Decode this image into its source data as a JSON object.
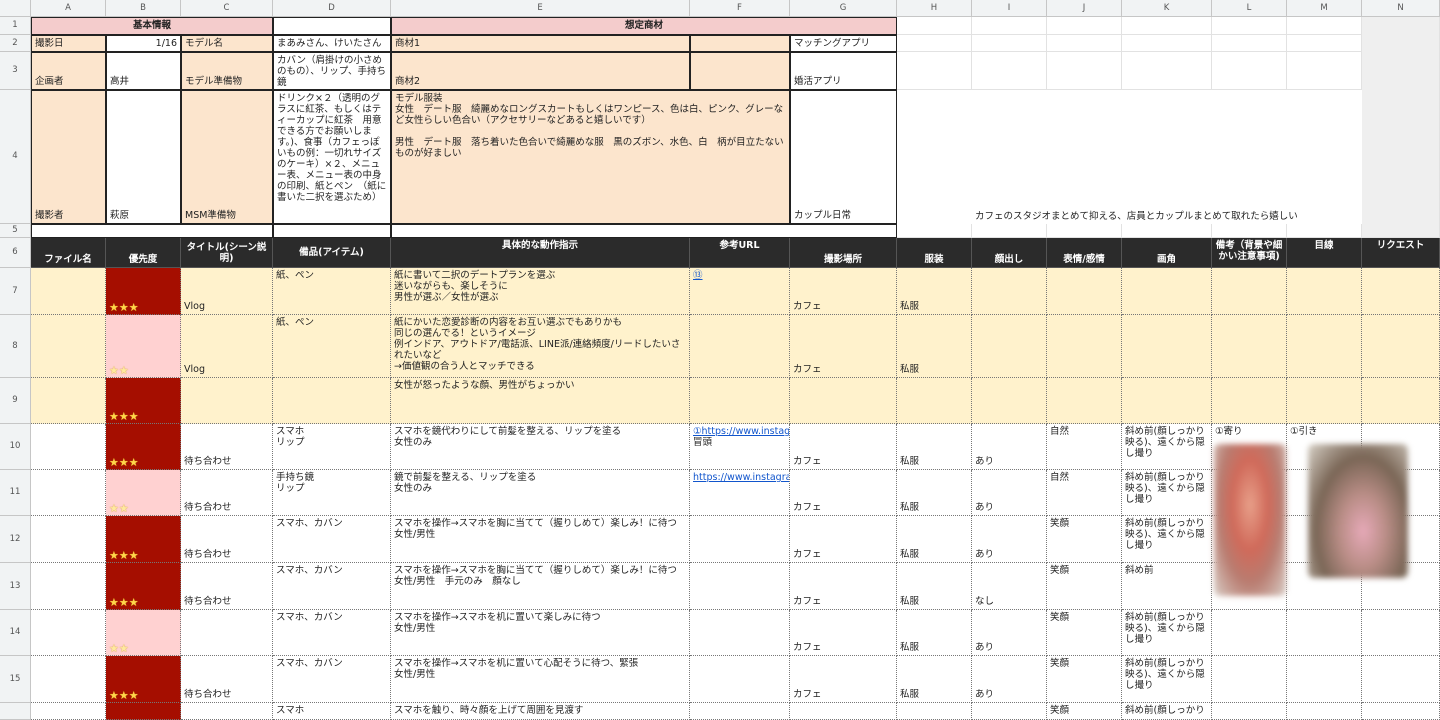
{
  "columns": [
    "A",
    "B",
    "C",
    "D",
    "E",
    "F",
    "G",
    "H",
    "I",
    "J",
    "K",
    "L",
    "M",
    "N"
  ],
  "rows": [
    "1",
    "2",
    "3",
    "4",
    "5",
    "6",
    "7",
    "8",
    "9",
    "10",
    "11",
    "12",
    "13",
    "14",
    "15",
    ""
  ],
  "info": {
    "title_basic": "基本情報",
    "title_product": "想定商材",
    "shoot_date_label": "撮影日",
    "shoot_date": "1/16",
    "model_name_label": "モデル名",
    "model_name": "まあみさん、けいたさん",
    "planner_label": "企画者",
    "planner": "高井",
    "model_prep_label": "モデル準備物",
    "model_prep": "カバン（肩掛けの小さめのもの）、リップ、手持ち鏡",
    "photographer_label": "撮影者",
    "photographer": "萩原",
    "msm_prep_label": "MSM準備物",
    "msm_prep": "ドリンク×２（透明のグラスに紅茶、もしくはティーカップに紅茶　用意できる方でお願いします。)、食事（カフェっぽいもの例：一切れサイズのケーキ）×２、メニュー表、メニュー表の中身の印刷、紙とペン　（紙に書いた二択を選ぶため）",
    "product1_label": "商材1",
    "product1": "マッチングアプリ",
    "product2_label": "商材2",
    "product2": "婚活アプリ",
    "outfit_text": "モデル服装\n女性　デート服　綺麗めなロングスカートもしくはワンピース、色は白、ピンク、グレーなど女性らしい色合い（アクセサリーなどあると嬉しいです）\n\n男性　デート服　落ち着いた色合いで綺麗めな服　黒のズボン、水色、白　柄が目立たないものが好ましい",
    "product3": "カップル日常",
    "note": "カフェのスタジオまとめて抑える、店員とカップルまとめて取れたら嬉しい"
  },
  "table_headers": {
    "file": "ファイル名",
    "priority": "優先度",
    "title": "タイトル(シーン説明)",
    "props": "備品(アイテム)",
    "action": "具体的な動作指示",
    "ref_url": "参考URL",
    "location": "撮影場所",
    "outfit": "服装",
    "face": "顔出し",
    "expression": "表情/感情",
    "angle": "画角",
    "remarks": "備考（背景や細かい注意事項)",
    "gaze": "目線",
    "request": "リクエスト"
  },
  "table_rows": [
    {
      "priority": "★★★",
      "level": 3,
      "title": "Vlog",
      "props": "紙、ペン",
      "action": "紙に書いて二択のデートプランを選ぶ\n迷いながらも、楽しそうに\n男性が選ぶ／女性が選ぶ",
      "ref": "⑬",
      "location": "カフェ",
      "outfit": "私服",
      "face": "",
      "expression": "",
      "angle": "",
      "remarks": "",
      "gaze": ""
    },
    {
      "priority": "★★",
      "level": 2,
      "title": "Vlog",
      "props": "紙、ペン",
      "action": "紙にかいた恋愛診断の内容をお互い選ぶでもありかも\n同じの選んでる！というイメージ\n例インドア、アウトドア/電話派、LINE派/連絡頻度/リードしたいされたいなど\n→価値観の合う人とマッチできる",
      "ref": "",
      "location": "カフェ",
      "outfit": "私服",
      "face": "",
      "expression": "",
      "angle": "",
      "remarks": "",
      "gaze": ""
    },
    {
      "priority": "★★★",
      "level": 3,
      "title": "",
      "props": "",
      "action": "女性が怒ったような顔、男性がちょっかい",
      "ref": "",
      "location": "",
      "outfit": "",
      "face": "",
      "expression": "",
      "angle": "",
      "remarks": "",
      "gaze": ""
    },
    {
      "priority": "★★★",
      "level": 3,
      "title": "待ち合わせ",
      "props": "スマホ\nリップ",
      "action": "スマホを鏡代わりにして前髪を整える、リップを塗る\n女性のみ",
      "ref": "①https://www.instagram.com",
      "ref_note": "冒頭",
      "location": "カフェ",
      "outfit": "私服",
      "face": "あり",
      "expression": "自然",
      "angle": "斜め前(顔しっかり映る)、遠くから隠し撮り",
      "remarks": "①寄り",
      "gaze": "①引き"
    },
    {
      "priority": "★★",
      "level": 2,
      "title": "待ち合わせ",
      "props": "手持ち鏡\nリップ",
      "action": "鏡で前髪を整える、リップを塗る\n女性のみ",
      "ref": "https://www.instagram.com",
      "location": "カフェ",
      "outfit": "私服",
      "face": "あり",
      "expression": "自然",
      "angle": "斜め前(顔しっかり映る)、遠くから隠し撮り",
      "remarks": "",
      "gaze": ""
    },
    {
      "priority": "★★★",
      "level": 3,
      "title": "待ち合わせ",
      "props": "スマホ、カバン",
      "action": "スマホを操作→スマホを胸に当てて（握りしめて）楽しみ！に待つ\n女性/男性",
      "ref": "",
      "location": "カフェ",
      "outfit": "私服",
      "face": "あり",
      "expression": "笑顔",
      "angle": "斜め前(顔しっかり映る)、遠くから隠し撮り",
      "remarks": "",
      "gaze": ""
    },
    {
      "priority": "★★★",
      "level": 3,
      "title": "待ち合わせ",
      "props": "スマホ、カバン",
      "action": "スマホを操作→スマホを胸に当てて（握りしめて）楽しみ！に待つ\n女性/男性　手元のみ　顔なし",
      "ref": "",
      "location": "カフェ",
      "outfit": "私服",
      "face": "なし",
      "expression": "笑顔",
      "angle": "斜め前",
      "remarks": "",
      "gaze": ""
    },
    {
      "priority": "★★",
      "level": 2,
      "title": "",
      "props": "スマホ、カバン",
      "action": "スマホを操作→スマホを机に置いて楽しみに待つ\n女性/男性",
      "ref": "",
      "location": "カフェ",
      "outfit": "私服",
      "face": "あり",
      "expression": "笑顔",
      "angle": "斜め前(顔しっかり映る)、遠くから隠し撮り",
      "remarks": "",
      "gaze": ""
    },
    {
      "priority": "★★★",
      "level": 3,
      "title": "待ち合わせ",
      "props": "スマホ、カバン",
      "action": "スマホを操作→スマホを机に置いて心配そうに待つ、緊張\n女性/男性",
      "ref": "",
      "location": "カフェ",
      "outfit": "私服",
      "face": "あり",
      "expression": "笑顔",
      "angle": "斜め前(顔しっかり映る)、遠くから隠し撮り",
      "remarks": "",
      "gaze": ""
    },
    {
      "priority": "",
      "level": 3,
      "title": "",
      "props": "スマホ",
      "action": "スマホを触り、時々顔を上げて周囲を見渡す",
      "ref": "",
      "location": "",
      "outfit": "",
      "face": "",
      "expression": "笑顔",
      "angle": "斜め前(顔しっかり",
      "remarks": "",
      "gaze": ""
    }
  ],
  "colors": {
    "section_header": "#f4cccc",
    "info_fill": "#fce5cd",
    "vlog_fill": "#fff2cc",
    "table_header": "#2b2b2b",
    "priority_high": "#a50e00",
    "priority_mid": "#ffd1d1",
    "star": "#ffd54a",
    "link": "#1155cc"
  }
}
